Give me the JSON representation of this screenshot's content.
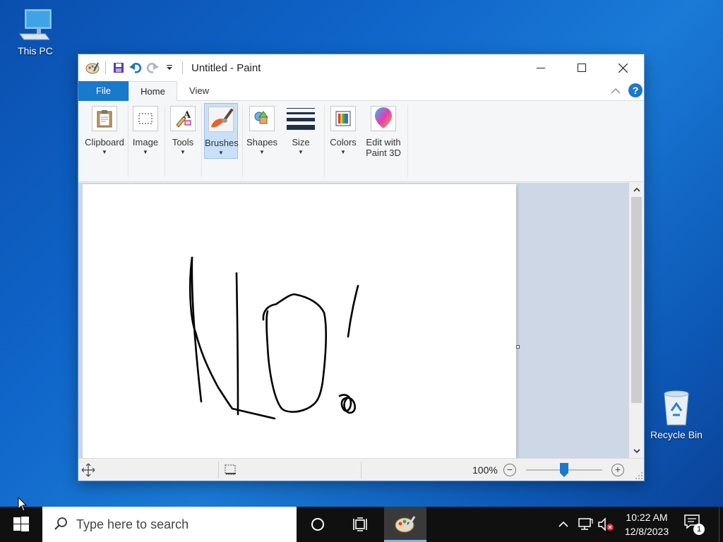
{
  "desktop": {
    "icons": [
      {
        "label": "This PC",
        "icon": "computer-icon"
      },
      {
        "label": "Recycle Bin",
        "icon": "recycle-bin-icon"
      }
    ]
  },
  "window": {
    "title": "Untitled - Paint",
    "quick_access": [
      "paint-app-icon",
      "save-icon",
      "undo-icon",
      "redo-icon",
      "customize-dropdown-icon"
    ],
    "controls": [
      "minimize-icon",
      "maximize-icon",
      "close-icon"
    ]
  },
  "ribbon": {
    "tabs": [
      {
        "label": "File",
        "active": false
      },
      {
        "label": "Home",
        "active": true
      },
      {
        "label": "View",
        "active": false
      }
    ],
    "help_label": "?",
    "groups": [
      {
        "label": "Clipboard",
        "icon": "clipboard-icon"
      },
      {
        "label": "Image",
        "icon": "select-rectangle-icon"
      },
      {
        "label": "Tools",
        "icon": "tools-icon"
      },
      {
        "label": "Brushes",
        "icon": "brush-icon",
        "selected": true
      },
      {
        "label": "Shapes",
        "icon": "shapes-icon"
      },
      {
        "label": "Size",
        "icon": "line-size-icon"
      },
      {
        "label": "Colors",
        "icon": "color-palette-icon"
      },
      {
        "label": "Edit with",
        "label2": "Paint 3D",
        "icon": "paint-3d-icon"
      }
    ]
  },
  "canvas": {
    "drawing_text": "No!",
    "stroke_color": "#000000"
  },
  "statusbar": {
    "zoom": "100%",
    "zoom_out_label": "−",
    "zoom_in_label": "+",
    "zoom_fraction": 0.5
  },
  "taskbar": {
    "search_placeholder": "Type here to search",
    "clock_time": "10:22 AM",
    "clock_date": "12/8/2023",
    "notification_count": "1"
  },
  "colors": {
    "accent": "#1979ca",
    "taskbar": "#101010",
    "desktop": "#0f64c8"
  }
}
